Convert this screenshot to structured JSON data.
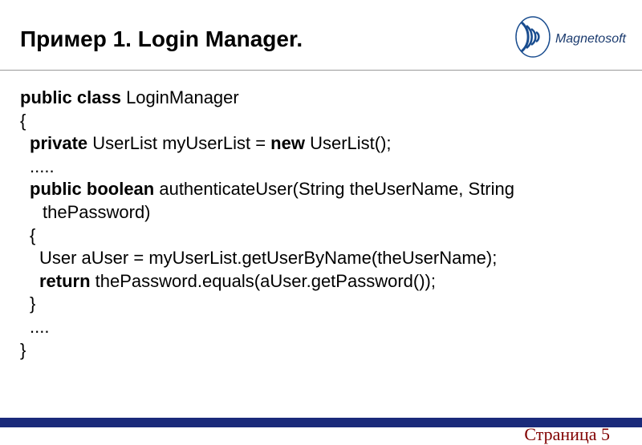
{
  "header": {
    "title": "Пример 1. Login Manager.",
    "logoText": "Magnetosoft"
  },
  "code": {
    "l1_kw": "public class",
    "l1_rest": " LoginManager",
    "l2": "{",
    "l3_kw1": "private",
    "l3_mid": " UserList myUserList = ",
    "l3_kw2": "new",
    "l3_end": " UserList();",
    "l4": ".....",
    "l5_kw": "public boolean",
    "l5_rest": " authenticateUser(String theUserName, String",
    "l6": "thePassword)",
    "l7": "{",
    "l8": "User aUser = myUserList.getUserByName(theUserName);",
    "l9_kw": "return",
    "l9_rest": " thePassword.equals(aUser.getPassword());",
    "l10": "}",
    "l11": "....",
    "l12": "}"
  },
  "footer": {
    "pageLabel": "Страница 5"
  }
}
